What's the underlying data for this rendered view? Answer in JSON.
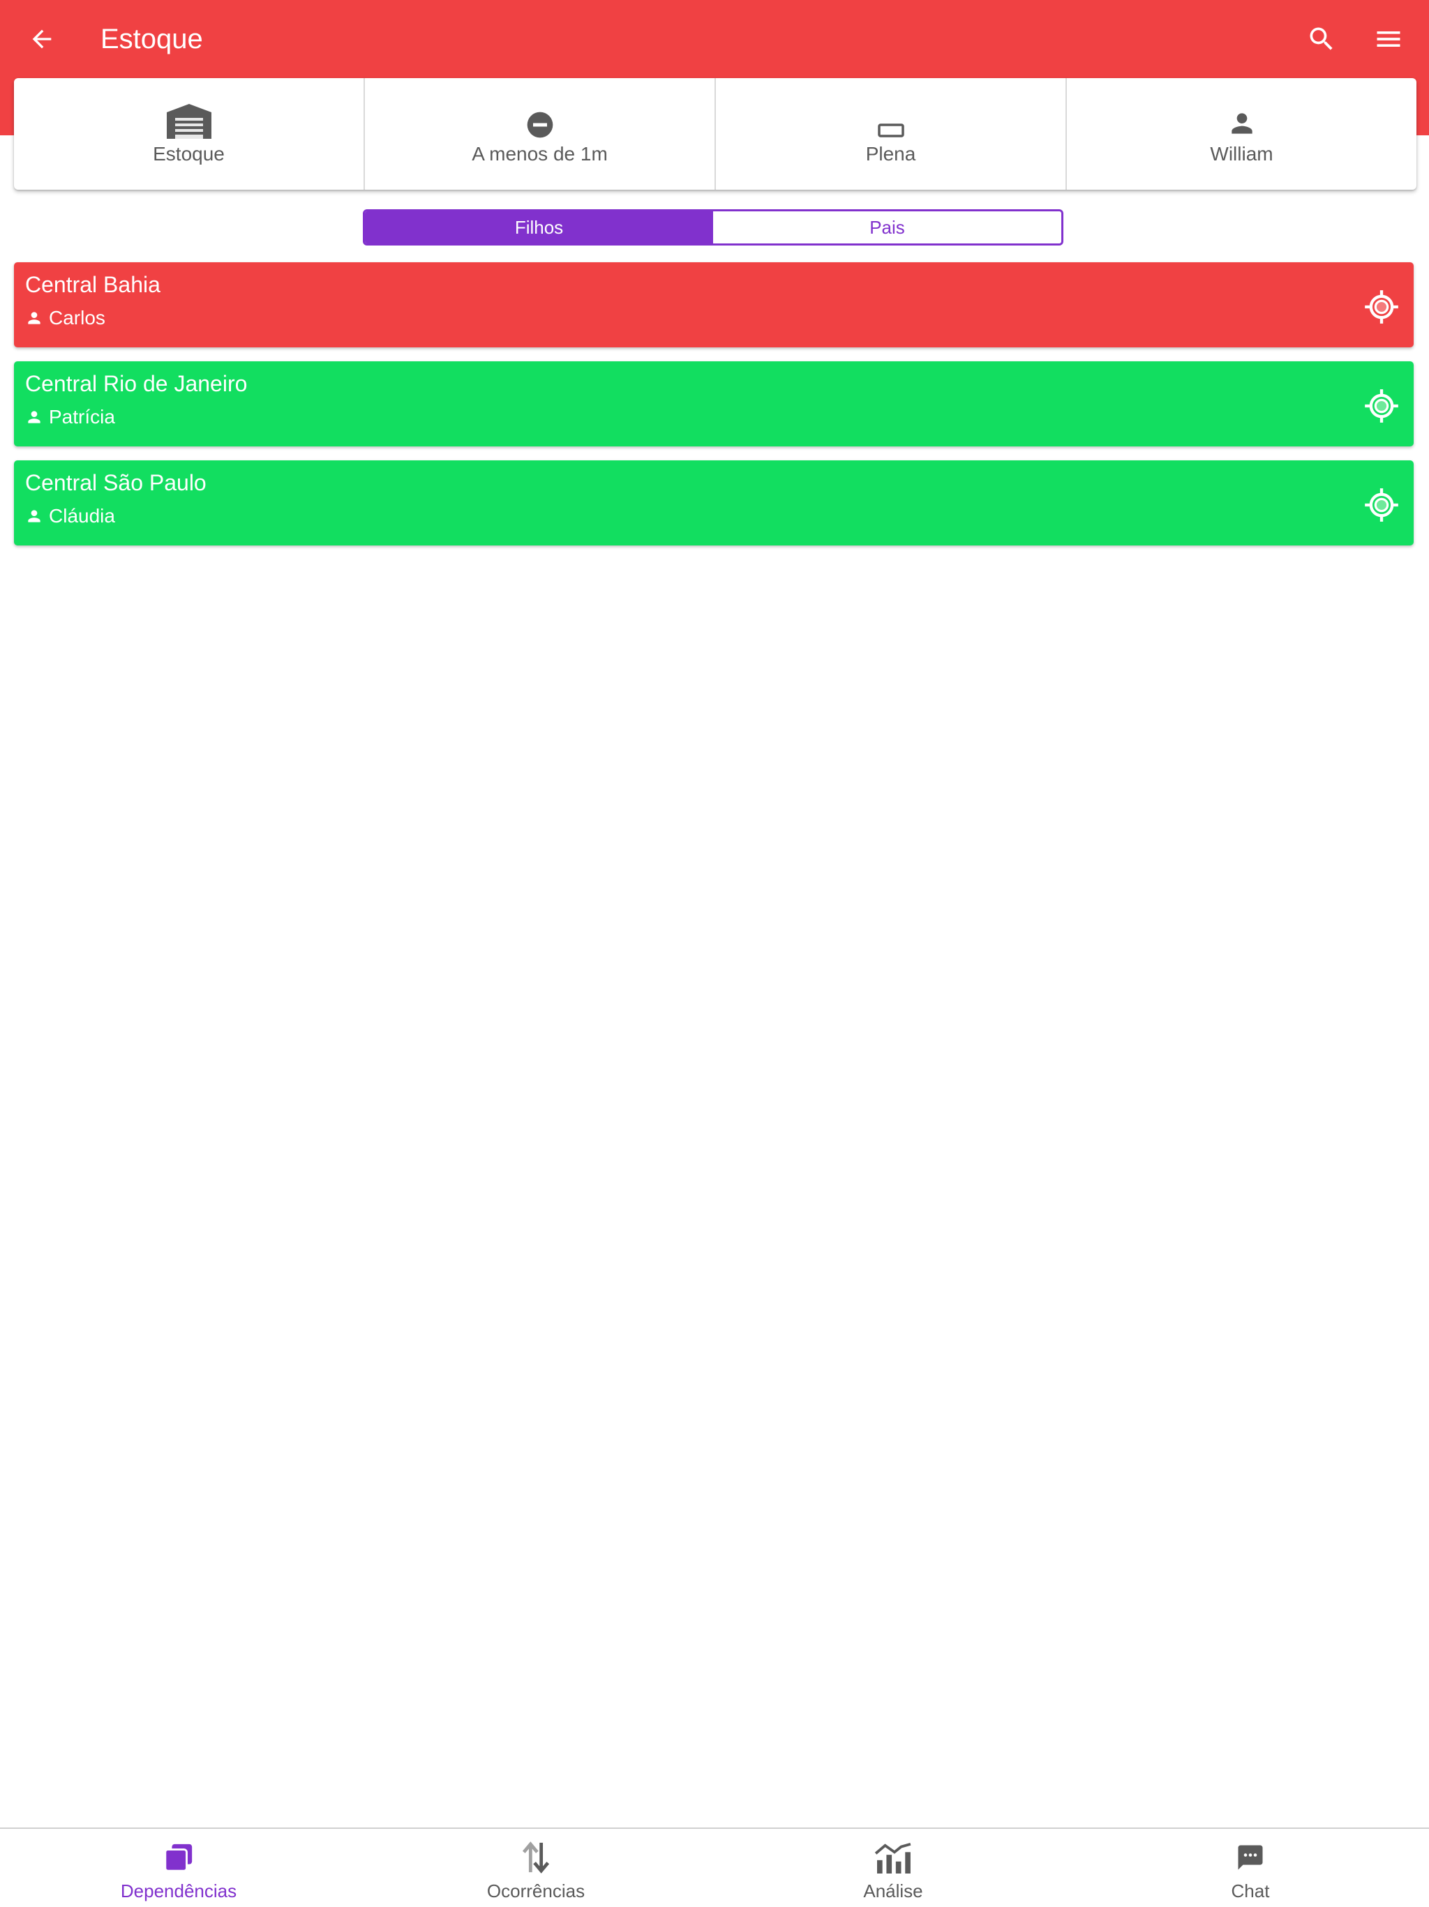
{
  "header": {
    "title": "Estoque",
    "background": "#f04143",
    "icons": [
      "arrow-back-icon",
      "search-icon",
      "menu-icon"
    ]
  },
  "info": [
    {
      "icon": "warehouse-icon",
      "label": "Estoque"
    },
    {
      "icon": "minus-circle-icon",
      "label": "A menos de 1m"
    },
    {
      "icon": "battery-rectangle-icon",
      "label": "Plena"
    },
    {
      "icon": "person-icon",
      "label": "William"
    }
  ],
  "segment": {
    "active": "Filhos",
    "inactive": "Pais",
    "accent": "#8131cd"
  },
  "items": [
    {
      "name": "Central Bahia",
      "person": "Carlos",
      "status": "red",
      "color": "#f04143",
      "icon": "gps-target-icon"
    },
    {
      "name": "Central Rio de Janeiro",
      "person": "Patrícia",
      "status": "green",
      "color": "#12de60",
      "icon": "gps-target-icon"
    },
    {
      "name": "Central São Paulo",
      "person": "Cláudia",
      "status": "green",
      "color": "#12de60",
      "icon": "gps-target-icon"
    }
  ],
  "bottom_nav": [
    {
      "label": "Dependências",
      "icon": "layers-icon",
      "active": true
    },
    {
      "label": "Ocorrências",
      "icon": "swap-vertical-icon",
      "active": false
    },
    {
      "label": "Análise",
      "icon": "analytics-icon",
      "active": false
    },
    {
      "label": "Chat",
      "icon": "chat-icon",
      "active": false
    }
  ]
}
